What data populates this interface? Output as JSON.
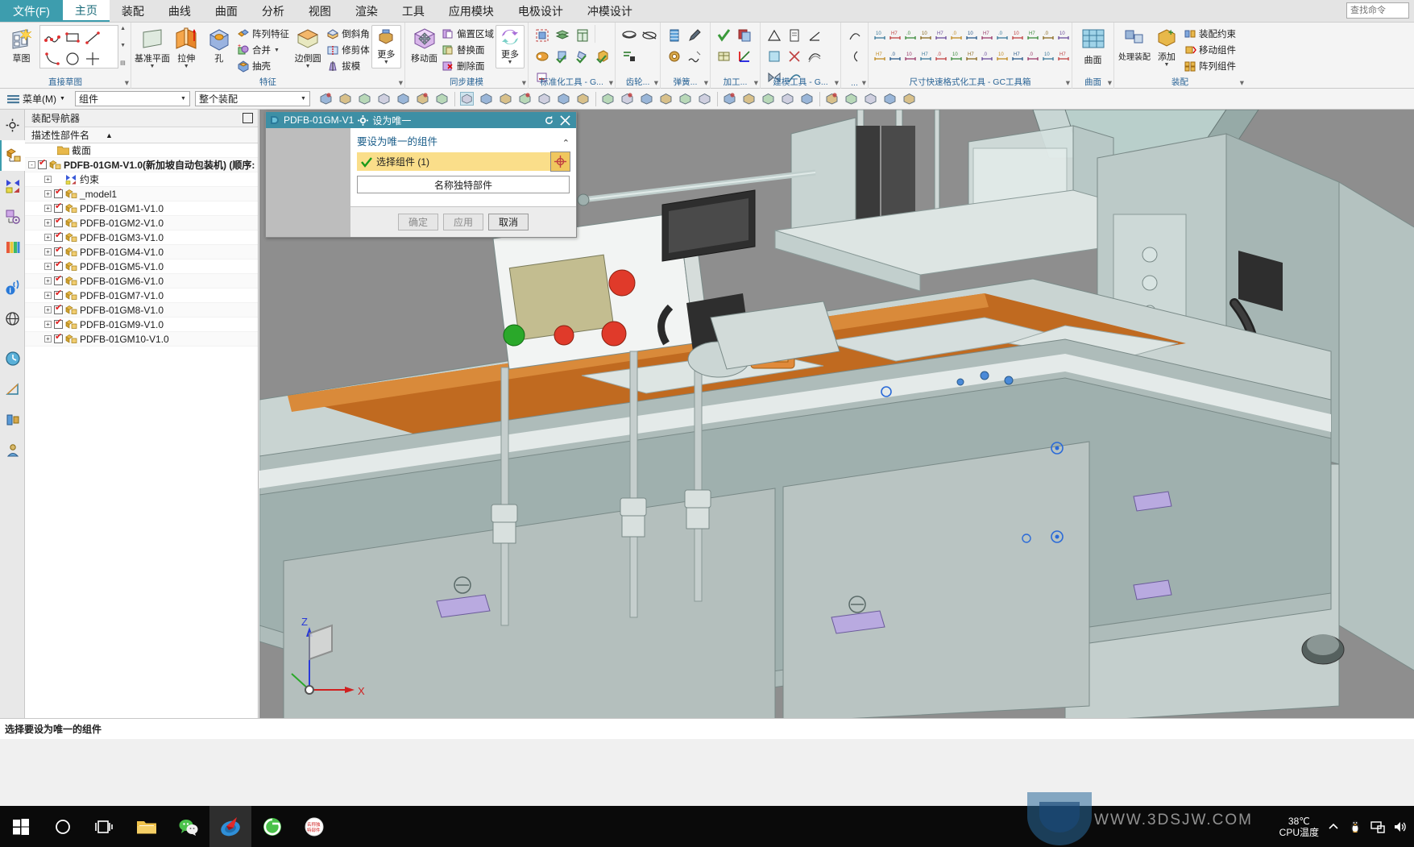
{
  "app": {
    "file_tab": "文件(F)",
    "ribbon_tabs": [
      {
        "label": "主页",
        "active": true
      },
      {
        "label": "装配",
        "active": false
      },
      {
        "label": "曲线",
        "active": false
      },
      {
        "label": "曲面",
        "active": false
      },
      {
        "label": "分析",
        "active": false
      },
      {
        "label": "视图",
        "active": false
      },
      {
        "label": "渲染",
        "active": false
      },
      {
        "label": "工具",
        "active": false
      },
      {
        "label": "应用模块",
        "active": false
      },
      {
        "label": "电极设计",
        "active": false
      },
      {
        "label": "冲模设计",
        "active": false
      }
    ],
    "find_command_placeholder": "查找命令"
  },
  "ribbon": {
    "groups": [
      {
        "label": "直接草图",
        "big": [
          {
            "label": "草图",
            "icon": "sketch-icon"
          }
        ],
        "sketch_tools": [
          "profile-icon",
          "rectangle-icon",
          "line-icon",
          "arc-icon",
          "circle-icon",
          "point-icon"
        ]
      },
      {
        "label": "特征",
        "big": [
          {
            "label": "基准平面",
            "icon": "datum-plane-icon",
            "dropdown": true
          },
          {
            "label": "拉伸",
            "icon": "extrude-icon",
            "dropdown": true
          },
          {
            "label": "孔",
            "icon": "hole-icon",
            "dropdown": false
          }
        ],
        "small": [
          {
            "label": "阵列特征",
            "icon": "pattern-feature-icon"
          },
          {
            "label": "合并",
            "icon": "unite-icon",
            "dropdown": true
          },
          {
            "label": "抽壳",
            "icon": "shell-icon"
          }
        ],
        "big2": [
          {
            "label": "边倒圆",
            "icon": "edge-blend-icon",
            "dropdown": true
          }
        ],
        "small2": [
          {
            "label": "倒斜角",
            "icon": "chamfer-icon"
          },
          {
            "label": "修剪体",
            "icon": "trim-body-icon"
          },
          {
            "label": "拔模",
            "icon": "draft-icon"
          }
        ],
        "more": {
          "label": "更多",
          "icon": "more-features-icon"
        }
      },
      {
        "label": "同步建模",
        "big": [
          {
            "label": "移动面",
            "icon": "move-face-icon"
          }
        ],
        "small": [
          {
            "label": "偏置区域",
            "icon": "offset-region-icon"
          },
          {
            "label": "替换面",
            "icon": "replace-face-icon"
          },
          {
            "label": "删除面",
            "icon": "delete-face-icon"
          }
        ],
        "more": {
          "label": "更多",
          "icon": "more-sync-icon"
        }
      },
      {
        "label": "标准化工具 - G...",
        "icon_count": 8
      },
      {
        "label": "齿轮...",
        "icon_count": 3
      },
      {
        "label": "弹簧...",
        "icon_count": 4
      },
      {
        "label": "加工...",
        "icon_count": 4
      },
      {
        "label": "建模工具 - G...",
        "icon_count": 8
      },
      {
        "label": "...",
        "icon_count": 2
      },
      {
        "label": "尺寸快速格式化工具 - GC工具箱",
        "icon_count": 26
      },
      {
        "label": "曲面",
        "big": [
          {
            "label": "曲面",
            "icon": "surface-icon"
          }
        ]
      },
      {
        "label": "装配",
        "big": [
          {
            "label": "处理装配",
            "icon": "assembly-handle-icon"
          },
          {
            "label": "添加",
            "icon": "add-component-icon",
            "dropdown": true
          }
        ],
        "small": [
          {
            "label": "装配约束",
            "icon": "assembly-constraint-icon"
          },
          {
            "label": "移动组件",
            "icon": "move-component-icon"
          },
          {
            "label": "阵列组件",
            "icon": "pattern-component-icon"
          }
        ]
      }
    ]
  },
  "toolbar": {
    "menu_label": "菜单(M)",
    "scope_filter": "组件",
    "assembly_filter": "整个装配"
  },
  "navigator": {
    "title": "装配导航器",
    "column_header": "描述性部件名",
    "sort_indicator": "▲",
    "tree": [
      {
        "label": "截面",
        "icon": "folder-icon",
        "indent": 1,
        "expander": null,
        "checkbox": null,
        "bold": false
      },
      {
        "label": "PDFB-01GM-V1.0(新加坡自动包装机)  (顺序:",
        "icon": "assembly-icon",
        "indent": 0,
        "expander": "-",
        "checkbox": "on",
        "bold": true
      },
      {
        "label": "约束",
        "icon": "constraint-icon",
        "indent": 2,
        "expander": "+",
        "checkbox": null,
        "bold": false
      },
      {
        "label": "_model1",
        "icon": "component-icon",
        "indent": 2,
        "expander": "+",
        "checkbox": "on",
        "bold": false
      },
      {
        "label": "PDFB-01GM1-V1.0",
        "icon": "component-icon",
        "indent": 2,
        "expander": "+",
        "checkbox": "on",
        "bold": false
      },
      {
        "label": "PDFB-01GM2-V1.0",
        "icon": "component-icon",
        "indent": 2,
        "expander": "+",
        "checkbox": "on",
        "bold": false
      },
      {
        "label": "PDFB-01GM3-V1.0",
        "icon": "component-icon",
        "indent": 2,
        "expander": "+",
        "checkbox": "on",
        "bold": false
      },
      {
        "label": "PDFB-01GM4-V1.0",
        "icon": "component-icon",
        "indent": 2,
        "expander": "+",
        "checkbox": "on",
        "bold": false
      },
      {
        "label": "PDFB-01GM5-V1.0",
        "icon": "component-icon",
        "indent": 2,
        "expander": "+",
        "checkbox": "on",
        "bold": false
      },
      {
        "label": "PDFB-01GM6-V1.0",
        "icon": "component-icon",
        "indent": 2,
        "expander": "+",
        "checkbox": "on",
        "bold": false
      },
      {
        "label": "PDFB-01GM7-V1.0",
        "icon": "component-icon",
        "indent": 2,
        "expander": "+",
        "checkbox": "on",
        "bold": false
      },
      {
        "label": "PDFB-01GM8-V1.0",
        "icon": "component-icon",
        "indent": 2,
        "expander": "+",
        "checkbox": "on",
        "bold": false
      },
      {
        "label": "PDFB-01GM9-V1.0",
        "icon": "component-icon",
        "indent": 2,
        "expander": "+",
        "checkbox": "on",
        "bold": false
      },
      {
        "label": "PDFB-01GM10-V1.0",
        "icon": "component-icon",
        "indent": 2,
        "expander": "+",
        "checkbox": "on",
        "bold": false
      }
    ]
  },
  "dialog": {
    "doc_name": "PDFB-01GM-V1",
    "title": "设为唯一",
    "section_label": "要设为唯一的组件",
    "select_label": "选择组件 (1)",
    "field_label": "名称独特部件",
    "buttons": [
      {
        "label": "确定",
        "enabled": false
      },
      {
        "label": "应用",
        "enabled": false
      },
      {
        "label": "取消",
        "enabled": true
      }
    ],
    "collapse_icon": "chevron-up-icon",
    "refresh_icon": "refresh-icon",
    "close_icon": "close-icon"
  },
  "status": {
    "message": "选择要设为唯一的组件"
  },
  "taskbar": {
    "items": [
      {
        "name": "start-button",
        "icon": "windows-icon"
      },
      {
        "name": "cortana-search",
        "icon": "circle-icon"
      },
      {
        "name": "task-view",
        "icon": "task-view-icon"
      },
      {
        "name": "file-explorer",
        "icon": "folder-icon"
      },
      {
        "name": "wechat",
        "icon": "wechat-icon"
      },
      {
        "name": "nx-app",
        "icon": "nx-icon",
        "active": true
      },
      {
        "name": "browser-360",
        "icon": "360-browser-icon"
      },
      {
        "name": "security-app",
        "icon": "security-icon"
      }
    ],
    "cpu_temp_value": "38℃",
    "cpu_temp_label": "CPU温度",
    "tray_icons": [
      "chevron-up-icon",
      "penguin-icon",
      "network-icon",
      "volume-icon"
    ]
  },
  "watermark": {
    "text": "WWW.3DSJW.COM"
  },
  "viewport": {
    "triad_labels": {
      "z": "Z",
      "x": "X"
    }
  },
  "colors": {
    "accent": "#3d9dae",
    "dialog_title": "#3d8fa5",
    "selection_highlight": "#fade8a",
    "tree_check": "#e02020",
    "viewport_bg": "#8e8e8e"
  }
}
